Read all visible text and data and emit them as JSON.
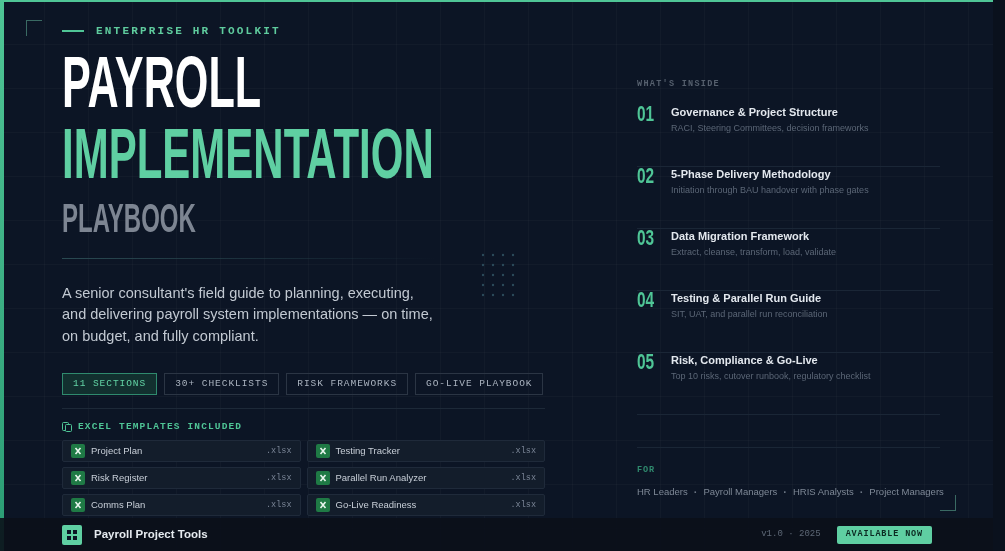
{
  "eyebrow": "ENTERPRISE HR TOOLKIT",
  "title": {
    "line_1": "PAYROLL",
    "line_2": "IMPLEMENTATION",
    "line_3": "PLAYBOOK"
  },
  "description": "A senior consultant's field guide to planning, executing, and delivering payroll system implementations — on time, on budget, and fully compliant.",
  "tags": [
    {
      "label": "11 SECTIONS",
      "selected": true
    },
    {
      "label": "30+ CHECKLISTS",
      "selected": false
    },
    {
      "label": "RISK FRAMEWORKS",
      "selected": false
    },
    {
      "label": "GO-LIVE PLAYBOOK",
      "selected": false
    }
  ],
  "templates": {
    "heading": "EXCEL TEMPLATES INCLUDED",
    "items": [
      {
        "name": "Project Plan",
        "ext": ".xlsx"
      },
      {
        "name": "Testing Tracker",
        "ext": ".xlsx"
      },
      {
        "name": "Risk Register",
        "ext": ".xlsx"
      },
      {
        "name": "Parallel Run Analyzer",
        "ext": ".xlsx"
      },
      {
        "name": "Comms Plan",
        "ext": ".xlsx"
      },
      {
        "name": "Go-Live Readiness",
        "ext": ".xlsx"
      }
    ]
  },
  "contents": {
    "heading": "WHAT'S INSIDE",
    "items": [
      {
        "number": "01",
        "title": "Governance & Project Structure",
        "subtitle": "RACI, Steering Committees, decision frameworks"
      },
      {
        "number": "02",
        "title": "5-Phase Delivery Methodology",
        "subtitle": "Initiation through BAU handover with phase gates"
      },
      {
        "number": "03",
        "title": "Data Migration Framework",
        "subtitle": "Extract, cleanse, transform, load, validate"
      },
      {
        "number": "04",
        "title": "Testing & Parallel Run Guide",
        "subtitle": "SIT, UAT, and parallel run reconciliation"
      },
      {
        "number": "05",
        "title": "Risk, Compliance & Go-Live",
        "subtitle": "Top 10 risks, cutover runbook, regulatory checklist"
      }
    ]
  },
  "audience": {
    "heading": "FOR",
    "separator": "·",
    "items": [
      "HR Leaders",
      "Payroll Managers",
      "HRIS Analysts",
      "Project Managers"
    ]
  },
  "footer": {
    "brand": "Payroll Project Tools",
    "version": "v1.0 · 2025",
    "cta": "AVAILABLE NOW"
  }
}
